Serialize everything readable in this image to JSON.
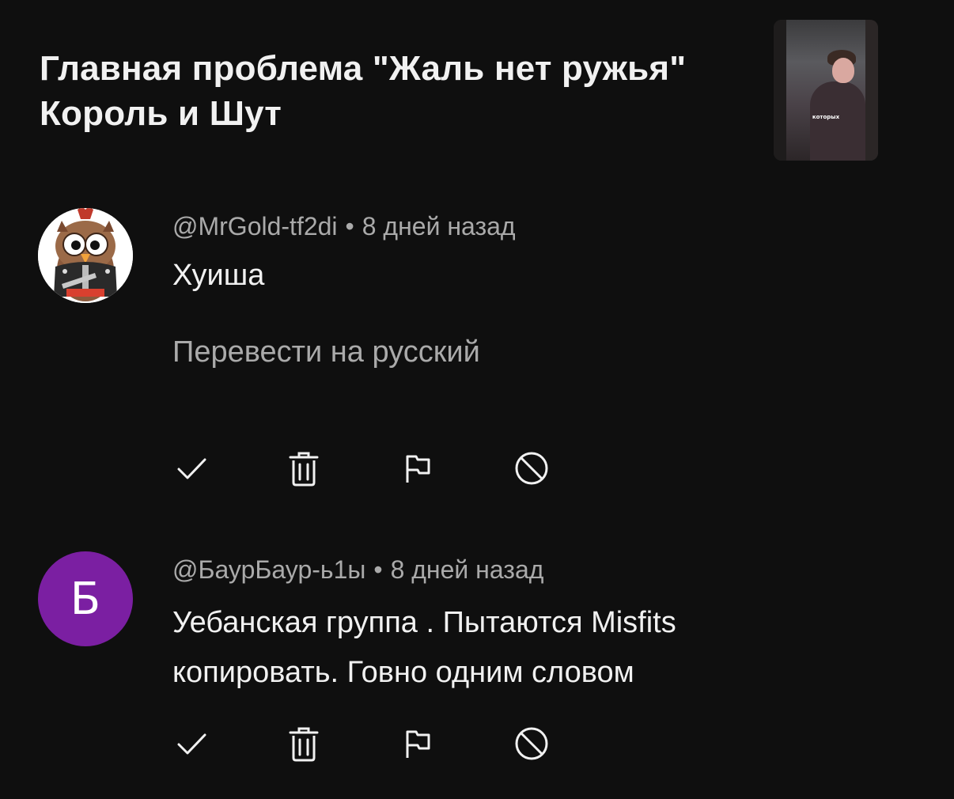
{
  "video": {
    "title": "Главная проблема \"Жаль нет ружья\" Король и Шут",
    "thumbnail_caption": "которых"
  },
  "comments": [
    {
      "author": "@MrGold-tf2di",
      "time": "8 дней назад",
      "text": "Хуиша",
      "translate_label": "Перевести на русский",
      "avatar_letter": ""
    },
    {
      "author": "@БаурБаур-ь1ы",
      "time": "8 дней назад",
      "text": "Уебанская группа . Пытаются Misfits копировать. Говно одним словом",
      "avatar_letter": "Б"
    }
  ],
  "separator": "•",
  "icons": [
    "check-icon",
    "trash-icon",
    "flag-icon",
    "block-icon"
  ],
  "colors": {
    "background": "#0f0f0f",
    "primary_text": "#f1f1f1",
    "secondary_text": "#aaaaaa",
    "avatar_purple": "#7b1fa2"
  }
}
